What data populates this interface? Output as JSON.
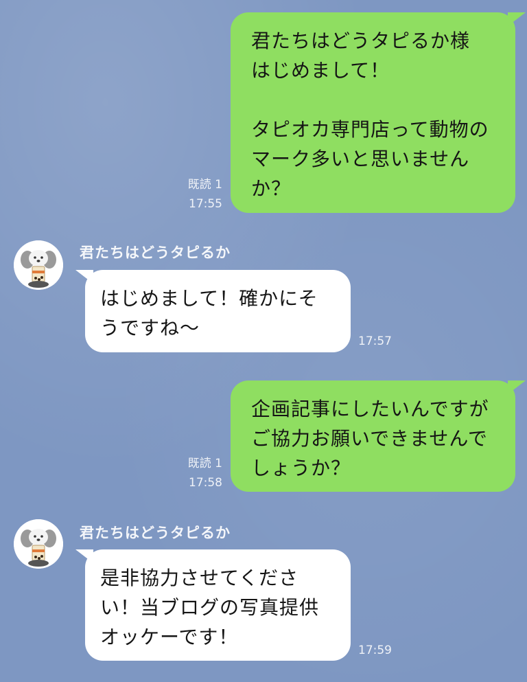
{
  "messages": [
    {
      "type": "sent",
      "text": "君たちはどうタピるか様\nはじめまして！\n\nタピオカ専門店って動物の\nマーク多いと思いません\nか？",
      "read": "既読 1",
      "time": "17:55"
    },
    {
      "type": "received",
      "sender": "君たちはどうタピるか",
      "text": "はじめまして！確かにそ\nうですね〜",
      "time": "17:57"
    },
    {
      "type": "sent",
      "text": "企画記事にしたいんですが\nご協力お願いできませんで\nしょうか？",
      "read": "既読 1",
      "time": "17:58"
    },
    {
      "type": "received",
      "sender": "君たちはどうタピるか",
      "text": "是非協力させてくださ\nい！当ブログの写真提供\nオッケーです！",
      "time": "17:59"
    }
  ],
  "avatar_icon": "dog-with-tapioca-drink-icon",
  "colors": {
    "background": "#7e97c2",
    "sent_bubble": "#8fde61",
    "received_bubble": "#ffffff"
  }
}
